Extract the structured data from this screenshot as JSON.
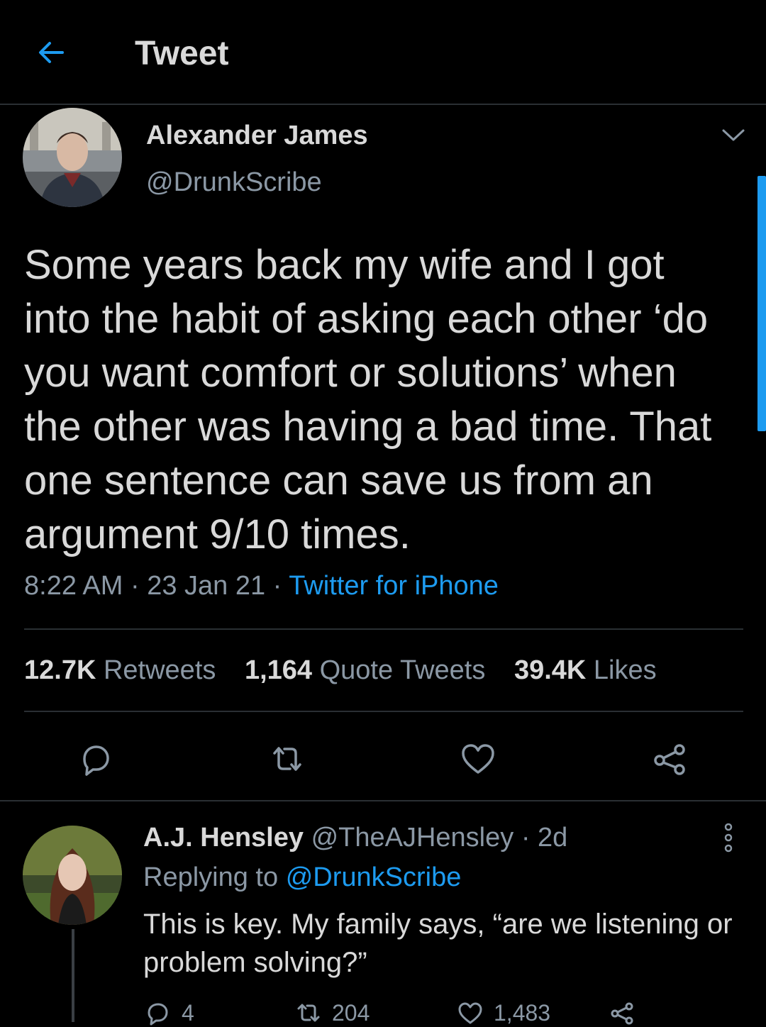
{
  "header": {
    "title": "Tweet"
  },
  "tweet": {
    "author_name": "Alexander James",
    "author_handle": "@DrunkScribe",
    "text": "Some years back my wife and I got into the habit of asking each other ‘do you want comfort or solutions’ when the other was having a bad time. That one sentence can save us from an argument 9/10 times.",
    "time": "8:22 AM",
    "separator": " · ",
    "date": "23 Jan 21",
    "source": "Twitter for iPhone",
    "stats": {
      "retweets_count": "12.7K",
      "retweets_label": "Retweets",
      "quotes_count": "1,164",
      "quotes_label": "Quote Tweets",
      "likes_count": "39.4K",
      "likes_label": "Likes"
    }
  },
  "reply": {
    "author_name": "A.J. Hensley",
    "author_handle": "@TheAJHensley",
    "age": "· 2d",
    "replying_label": "Replying to",
    "replying_mention": "@DrunkScribe",
    "text": "This is key. My family says, “are we listening or problem solving?”",
    "reply_count": "4",
    "retweet_count": "204",
    "like_count": "1,483"
  },
  "colors": {
    "background": "#000000",
    "text": "#d9d9d9",
    "muted": "#8b98a5",
    "accent": "#1d9bf0",
    "divider": "#2a2f33"
  },
  "icons": [
    "arrow-left-icon",
    "chevron-down-icon",
    "reply-icon",
    "retweet-icon",
    "heart-icon",
    "share-icon",
    "more-vertical-icon"
  ]
}
